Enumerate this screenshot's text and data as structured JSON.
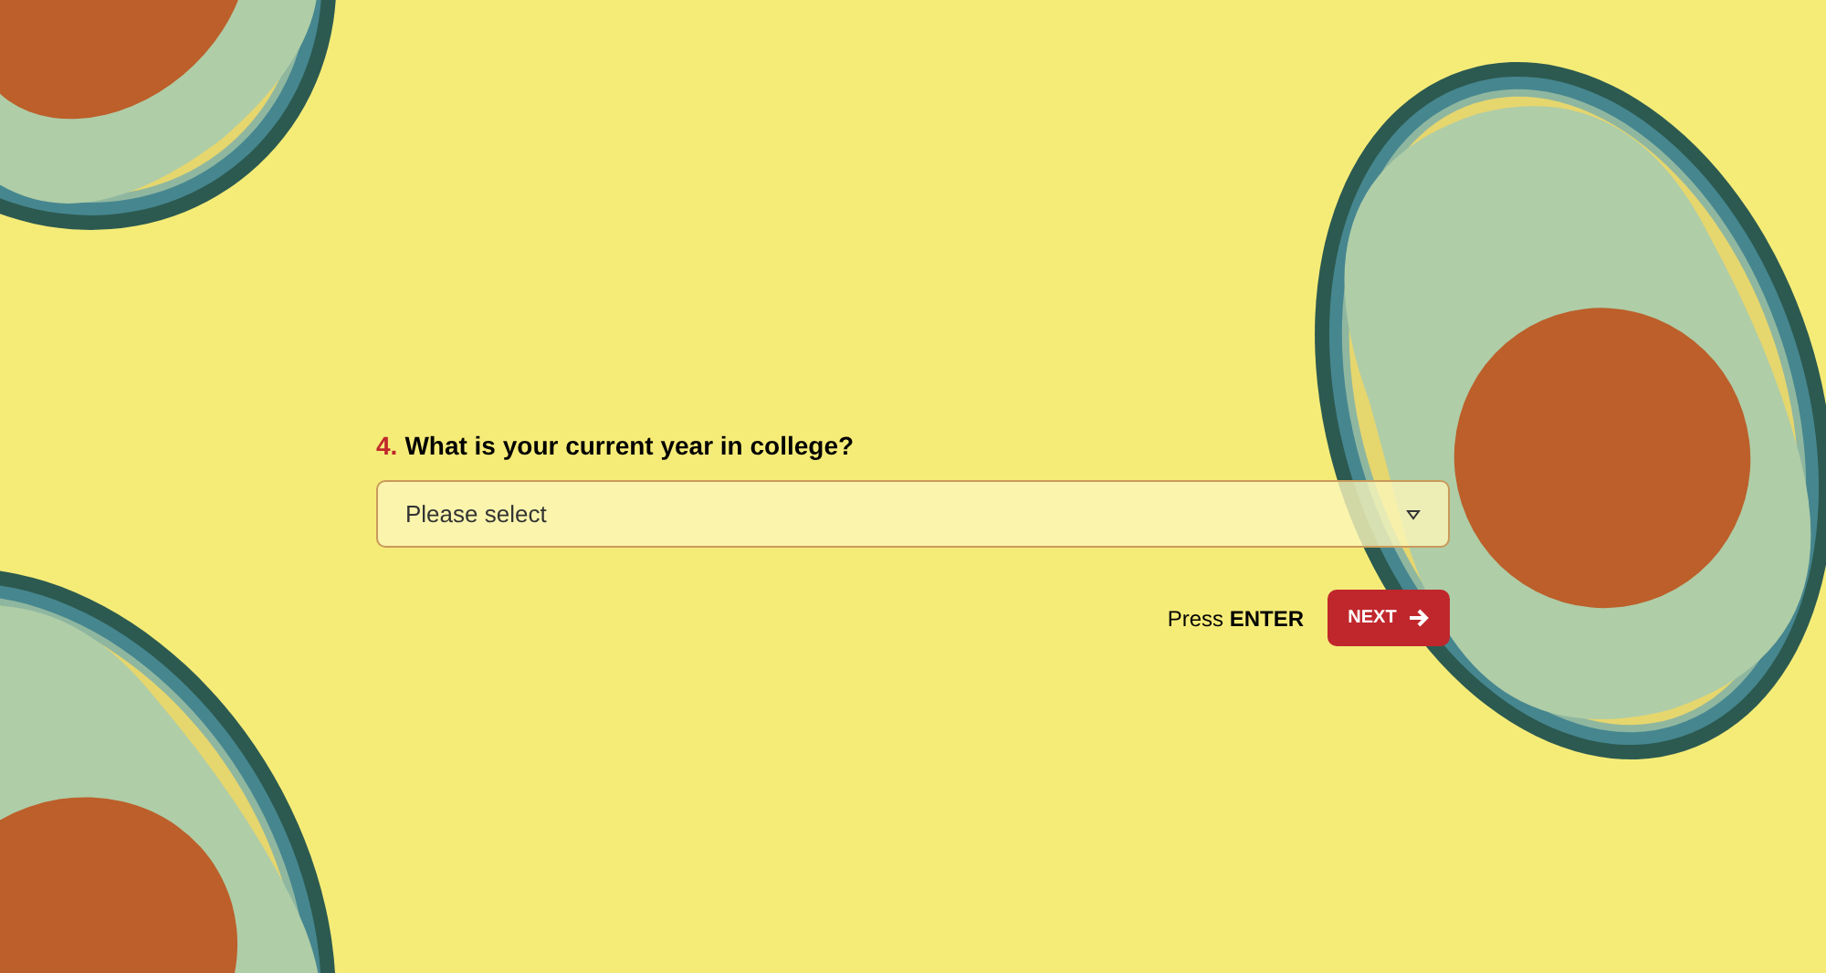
{
  "question": {
    "number": "4.",
    "text": "What is your current year in college?"
  },
  "select": {
    "placeholder": "Please select"
  },
  "hint": "Press **ENTER**",
  "next_button": {
    "label": "NEXT"
  }
}
